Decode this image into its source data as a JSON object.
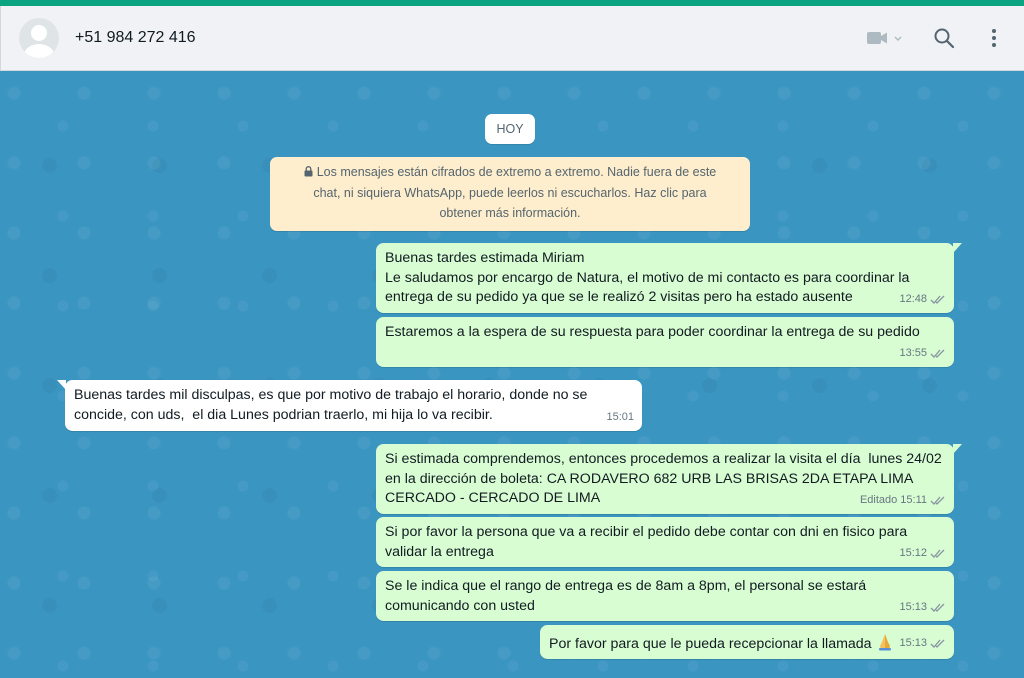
{
  "header": {
    "contact": "+51 984 272 416",
    "icons": [
      "video-call-icon",
      "search-icon",
      "menu-icon"
    ]
  },
  "chat": {
    "date_label": "HOY",
    "encryption_notice": "Los mensajes están cifrados de extremo a extremo. Nadie fuera de este chat, ni siquiera WhatsApp, puede leerlos ni escucharlos. Haz clic para obtener más información.",
    "messages": [
      {
        "direction": "out",
        "text": "Buenas tardes estimada Miriam\nLe saludamos por encargo de Natura, el motivo de mi contacto es para coordinar la entrega de su pedido ya que se le realizó 2 visitas pero ha estado ausente",
        "time": "12:48",
        "edited": ""
      },
      {
        "direction": "out",
        "text": "Estaremos a la espera de su respuesta para poder coordinar la entrega de su pedido",
        "time": "13:55",
        "edited": ""
      },
      {
        "direction": "in",
        "text": "Buenas tardes mil disculpas, es que por motivo de trabajo el horario, donde no se concide, con uds,  el dia Lunes podrian traerlo, mi hija lo va recibir.",
        "time": "15:01",
        "edited": ""
      },
      {
        "direction": "out",
        "text": "Si estimada comprendemos, entonces procedemos a realizar la visita el día  lunes 24/02 en la dirección de boleta: CA RODAVERO 682 URB LAS BRISAS 2DA ETAPA LIMA CERCADO - CERCADO DE LIMA",
        "time": "15:11",
        "edited": "Editado"
      },
      {
        "direction": "out",
        "text": "Si por favor la persona que va a recibir el pedido debe contar con dni en fisico para validar la entrega",
        "time": "15:12",
        "edited": ""
      },
      {
        "direction": "out",
        "text": "Se le indica que el rango de entrega es de 8am a 8pm, el personal se estará comunicando con usted",
        "time": "15:13",
        "edited": ""
      },
      {
        "direction": "out",
        "text": "Por favor para que le pueda recepcionar la llamada",
        "time": "15:13",
        "edited": "",
        "emoji": "folded-hands-icon"
      }
    ]
  },
  "colors": {
    "accent": "#0aa481",
    "wallpaper": "#3a95c1",
    "outgoing_bubble": "#d9fdd3",
    "incoming_bubble": "#ffffff",
    "notice_bg": "#ffeecd",
    "read_tick": "#8696a0"
  }
}
